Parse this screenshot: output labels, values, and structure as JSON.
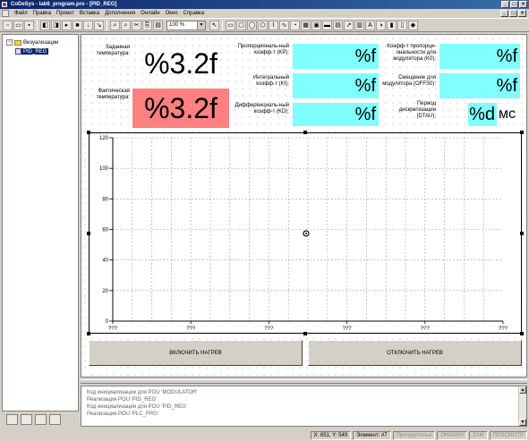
{
  "window": {
    "title": "CoDeSys - lab6_program.pro - [PID_REG]"
  },
  "menu": [
    "Файл",
    "Правка",
    "Проект",
    "Вставка",
    "Дополнения",
    "Онлайн",
    "Окно",
    "Справка"
  ],
  "toolbar": {
    "zoom": "100 %"
  },
  "tree": {
    "root": "Визуализации",
    "child": "PID_REG"
  },
  "visual": {
    "set_temp_label": "Заданная температура:",
    "act_temp_label": "Фактическая температура:",
    "set_temp_value": "%3.2f",
    "act_temp_value": "%3.2f",
    "kp_label": "Пропорциональ-ный коэфф-т (KP):",
    "ki_label": "Интегральный коэфф-т (KI):",
    "kd_label": "Дифференциаль-ный коэфф-т (KD):",
    "kp_value": "%f",
    "ki_value": "%f",
    "kd_value": "%f",
    "k0_label": "Коэфф-т пропорци-ональности для модулятора (K0):",
    "offs0_label": "Смещение для модулятора (OFFS0):",
    "dtau_label": "Период дискретизации (DTAU):",
    "k0_value": "%f",
    "offs0_value": "%f",
    "dtau_value": "%d",
    "dtau_unit": "мс",
    "btn_on": "ВКЛЮЧИТЬ НАГРЕВ",
    "btn_off": "ОТКЛЮЧИТЬ НАГРЕВ",
    "colors": {
      "value_bg": "#80ffff",
      "actual_bg": "#ff8080"
    }
  },
  "chart_data": {
    "type": "line",
    "ylim": [
      0,
      120
    ],
    "yticks": [
      "120",
      "100",
      "80",
      "60",
      "40",
      "20",
      "0"
    ],
    "xticks": [
      "???",
      "???",
      "???",
      "???",
      "???",
      "???"
    ],
    "series": [],
    "grid": true
  },
  "messages": [
    "Код инициализации для POU 'MODULATOR'",
    "Реализация POU 'PID_REG'",
    "Код инициализации для POU 'PID_REG'",
    "Реализация POU 'PLC_PRG'"
  ],
  "status": {
    "coords": "X: 651, Y: 549",
    "element": "Элемент: #7",
    "mode1": "Принудительн",
    "mode2": "ОНЛАЙН",
    "mode3": "ЗАМ",
    "mode4": "ПРОСМОТР"
  }
}
